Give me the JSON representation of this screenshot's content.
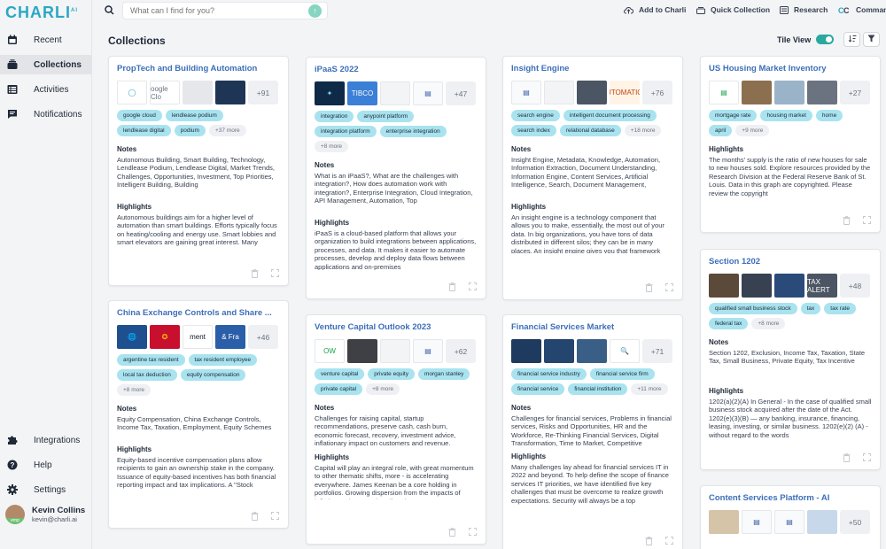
{
  "app": {
    "logo": "CHARLI",
    "logo_sup": "AI"
  },
  "search": {
    "placeholder": "What can I find for you?"
  },
  "toolbar": {
    "add": "Add to Charli",
    "quick": "Quick Collection",
    "research": "Research",
    "commands": "Comman"
  },
  "nav": [
    {
      "label": "Recent",
      "icon": "clock-icon"
    },
    {
      "label": "Collections",
      "icon": "stack-icon"
    },
    {
      "label": "Activities",
      "icon": "list-icon"
    },
    {
      "label": "Notifications",
      "icon": "chat-icon"
    }
  ],
  "nav_bottom": [
    {
      "label": "Integrations",
      "icon": "puzzle-icon"
    },
    {
      "label": "Help",
      "icon": "help-icon"
    },
    {
      "label": "Settings",
      "icon": "gear-icon"
    }
  ],
  "user": {
    "name": "Kevin Collins",
    "email": "kevin@charli.ai",
    "badge": "emp"
  },
  "page": {
    "title": "Collections",
    "tile_view": "Tile View"
  },
  "colors": {
    "accent": "#2aa8c4",
    "title_link": "#3d6fb8",
    "tag": "#a8e3ef",
    "toggle": "#2aa8a0"
  },
  "cards": [
    {
      "title": "PropTech and Building Automation",
      "thumbs": [
        {
          "bg": "#ffffff",
          "fg": "#2aa8c4",
          "txt": "◯"
        },
        {
          "bg": "#ffffff",
          "fg": "#6b7280",
          "txt": "oogle Clo"
        },
        {
          "bg": "#e5e7eb",
          "fg": "#9ca3af",
          "txt": ""
        },
        {
          "bg": "#1f3556",
          "fg": "#ffffff",
          "txt": ""
        }
      ],
      "more": "+91",
      "tags": [
        "google cloud",
        "lendlease podium",
        "lendlease digital",
        "podium"
      ],
      "tags_more": "+37 more",
      "notes_label": "Notes",
      "notes": "Autonomous Building, Smart Building, Technology, Lendlease Podium, Lendlease Digital, Market Trends, Challenges, Opportunities, Investment, Top Priorities, Intelligent Building, Building",
      "highlights_label": "Highlights",
      "highlights": "Autonomous buildings aim for a higher level of automation than smart buildings. Efforts typically focus on heating/cooling and energy use. Smart lobbies and smart elevators are gaining great interest. Many industry leaders believe autonomous"
    },
    {
      "title": "iPaaS 2022",
      "thumbs": [
        {
          "bg": "#0e2a47",
          "fg": "#7fd1f0",
          "txt": "✦"
        },
        {
          "bg": "#3b7fd6",
          "fg": "#ffffff",
          "txt": "TIBCO"
        },
        {
          "bg": "#f3f4f6",
          "fg": "#9ca3af",
          "txt": ""
        },
        {
          "bg": "#f8fafc",
          "fg": "#3b5ba5",
          "txt": "▤"
        }
      ],
      "more": "+47",
      "tags": [
        "integration",
        "anypoint platform",
        "integration platform",
        "enterprise integration"
      ],
      "tags_more": "+8 more",
      "notes_label": "Notes",
      "notes": "What is an iPaaS?, What are the challenges with integration?, How does automation work with integration?, Enterprise Integration, Cloud Integration, API Management, Automation, Top",
      "highlights_label": "Highlights",
      "highlights": "iPaaS is a cloud-based platform that allows your organization to build integrations between applications, processes, and data. It makes it easier to automate processes, develop and deploy data flows between applications and on-premises"
    },
    {
      "title": "Insight Engine",
      "thumbs": [
        {
          "bg": "#f8fafc",
          "fg": "#3b5ba5",
          "txt": "▤"
        },
        {
          "bg": "#f3f4f6",
          "fg": "#9ca3af",
          "txt": ""
        },
        {
          "bg": "#4b5563",
          "fg": "#ffffff",
          "txt": ""
        },
        {
          "bg": "#fff4e6",
          "fg": "#c2410c",
          "txt": "AUTOMATION"
        }
      ],
      "more": "+76",
      "tags": [
        "search engine",
        "intelligent document processing",
        "search index",
        "relational database"
      ],
      "tags_more": "+18 more",
      "notes_label": "Notes",
      "notes": "Insight Engine, Metadata, Knowledge, Automation, Information Extraction, Document Understanding, Information Engine, Content Services, Artificial Intelligence, Search, Document Management,",
      "highlights_label": "Highlights",
      "highlights": "An insight engine is a technology component that allows you to make, essentially, the most out of your data. In big organizations, you have tons of data distributed in different silos; they can be in many places. An insight engine gives you that framework"
    },
    {
      "title": "US Housing Market Inventory",
      "thumbs": [
        {
          "bg": "#ffffff",
          "fg": "#16a34a",
          "txt": "▤"
        },
        {
          "bg": "#8b6f4e",
          "fg": "#ffffff",
          "txt": ""
        },
        {
          "bg": "#9bb3c9",
          "fg": "#ffffff",
          "txt": ""
        },
        {
          "bg": "#6b7280",
          "fg": "#ffffff",
          "txt": ""
        }
      ],
      "more": "+27",
      "tags": [
        "mortgage rate",
        "housing market",
        "home",
        "april"
      ],
      "tags_more": "+9 more",
      "highlights_label": "Highlights",
      "highlights": "The months' supply is the ratio of new houses for sale to new houses sold. Explore resources provided by the Research Division at the Federal Reserve Bank of St. Louis. Data in this graph are copyrighted. Please review the copyright"
    },
    {
      "title": "Section 1202",
      "thumbs": [
        {
          "bg": "#5b4a3a",
          "fg": "#ffffff",
          "txt": ""
        },
        {
          "bg": "#374151",
          "fg": "#ffffff",
          "txt": ""
        },
        {
          "bg": "#2a4a7a",
          "fg": "#ffffff",
          "txt": ""
        },
        {
          "bg": "#4b5563",
          "fg": "#ffffff",
          "txt": "TAX ALERT"
        }
      ],
      "more": "+48",
      "tags": [
        "qualified small business stock",
        "tax",
        "tax rate",
        "federal tax"
      ],
      "tags_more": "+8 more",
      "notes_label": "Notes",
      "notes": "Section 1202, Exclusion, Income Tax, Taxation, State Tax, Small Business, Private Equity, Tax Incentive",
      "highlights_label": "Highlights",
      "highlights": "1202(a)(2)(A) In General - In the case of qualified small business stock acquired after the date of the Act. 1202(e)(3)(B) — any banking, insurance, financing, leasing, investing, or similar business. 1202(e)(2) (A) - without regard to the words"
    },
    {
      "title": "China Exchange Controls and Share ...",
      "thumbs": [
        {
          "bg": "#1e4f8f",
          "fg": "#ffffff",
          "txt": "🌐"
        },
        {
          "bg": "#c8102e",
          "fg": "#f5c400",
          "txt": "✪"
        },
        {
          "bg": "#ffffff",
          "fg": "#111827",
          "txt": "ment"
        },
        {
          "bg": "#2b5ea8",
          "fg": "#ffffff",
          "txt": "& Fra"
        }
      ],
      "more": "+46",
      "tags": [
        "argentine tax resident",
        "tax resident employee",
        "local tax deduction",
        "equity compensation"
      ],
      "tags_more": "+8 more",
      "notes_label": "Notes",
      "notes": "Equity Compensation, China Exchange Controls, Income Tax, Taxation, Employment, Equity Schemes",
      "highlights_label": "Highlights",
      "highlights": "Equity-based incentive compensation plans allow recipients to gain an ownership stake in the company. Issuance of equity-based incentives has both financial reporting impact and tax implications. A \"Stock Recharge Agreement\" is a"
    },
    {
      "title": "Venture Capital Outlook 2023",
      "thumbs": [
        {
          "bg": "#ffffff",
          "fg": "#16a34a",
          "txt": "OW"
        },
        {
          "bg": "#3f3f46",
          "fg": "#ffffff",
          "txt": ""
        },
        {
          "bg": "#f3f4f6",
          "fg": "#9ca3af",
          "txt": ""
        },
        {
          "bg": "#f8fafc",
          "fg": "#3b5ba5",
          "txt": "▤"
        }
      ],
      "more": "+62",
      "tags": [
        "venture capital",
        "private equity",
        "morgan stanley",
        "private capital"
      ],
      "tags_more": "+8 more",
      "notes_label": "Notes",
      "notes": "Challenges for raising capital, startup recommendations, preserve cash, cash burn, economic forecast, recovery, investment advice, inflationary impact on customers and revenue.",
      "highlights_label": "Highlights",
      "highlights": "Capital will play an integral role, with great momentum to other thematic shifts, more - is accelerating everywhere. James Keenan be a core holding in portfolios. Growing dispersion from the impacts of inflation and economic policy changes"
    },
    {
      "title": "Financial Services Market",
      "thumbs": [
        {
          "bg": "#1e3a5f",
          "fg": "#ffffff",
          "txt": ""
        },
        {
          "bg": "#24456e",
          "fg": "#ffffff",
          "txt": ""
        },
        {
          "bg": "#3a5f86",
          "fg": "#ffffff",
          "txt": ""
        },
        {
          "bg": "#ffffff",
          "fg": "#111827",
          "txt": "🔍"
        }
      ],
      "more": "+71",
      "tags": [
        "financial service industry",
        "financial service firm",
        "financial service",
        "financial institution"
      ],
      "tags_more": "+11 more",
      "notes_label": "Notes",
      "notes": "Challenges for financial services, Problems in financial services, Risks and Opportunities, HR and the Workforce, Re-Thinking Financial Services, Digital Transformation, Time to Market, Competitive",
      "highlights_label": "Highlights",
      "highlights": "Many challenges lay ahead for financial services IT in 2022 and beyond. To help define the scope of finance services IT priorities, we have identified five key challenges that must be overcome to realize growth expectations. Security will always be a top"
    },
    {
      "title": "Content Services Platform - AI",
      "thumbs": [
        {
          "bg": "#d6c4a8",
          "fg": "#ffffff",
          "txt": ""
        },
        {
          "bg": "#f8fafc",
          "fg": "#3b5ba5",
          "txt": "▤"
        },
        {
          "bg": "#f8fafc",
          "fg": "#3b5ba5",
          "txt": "▤"
        },
        {
          "bg": "#c7d8ea",
          "fg": "#ffffff",
          "txt": ""
        }
      ],
      "more": "+50",
      "tags": [],
      "tags_more": ""
    }
  ]
}
